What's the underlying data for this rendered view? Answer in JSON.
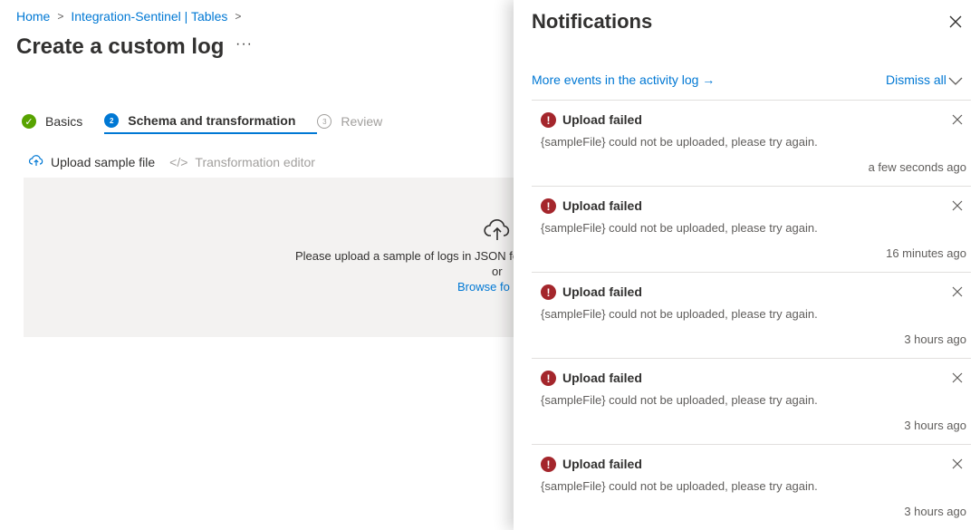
{
  "breadcrumb": {
    "home": "Home",
    "workspace": "Integration-Sentinel | Tables"
  },
  "page": {
    "title": "Create a custom log",
    "more": "···"
  },
  "wizard": {
    "steps": [
      {
        "number": "✓",
        "label": "Basics",
        "state": "done"
      },
      {
        "number": "2",
        "label": "Schema and transformation",
        "state": "active"
      },
      {
        "number": "3",
        "label": "Review",
        "state": "todo"
      }
    ]
  },
  "toolbar": {
    "upload_label": "Upload sample file",
    "editor_label": "Transformation editor"
  },
  "dropzone": {
    "instruction": "Please upload a sample of logs in JSON fo",
    "or": "or",
    "browse": "Browse fo"
  },
  "notifications": {
    "title": "Notifications",
    "activity_link": "More events in the activity log →",
    "dismiss_all": "Dismiss all",
    "items": [
      {
        "title": "Upload failed",
        "message": "{sampleFile} could not be uploaded, please try again.",
        "time": "a few seconds ago"
      },
      {
        "title": "Upload failed",
        "message": "{sampleFile} could not be uploaded, please try again.",
        "time": "16 minutes ago"
      },
      {
        "title": "Upload failed",
        "message": "{sampleFile} could not be uploaded, please try again.",
        "time": "3 hours ago"
      },
      {
        "title": "Upload failed",
        "message": "{sampleFile} could not be uploaded, please try again.",
        "time": "3 hours ago"
      },
      {
        "title": "Upload failed",
        "message": "{sampleFile} could not be uploaded, please try again.",
        "time": "3 hours ago"
      }
    ]
  },
  "colors": {
    "accent": "#0078d4",
    "error": "#a4262c",
    "success": "#57a300"
  }
}
